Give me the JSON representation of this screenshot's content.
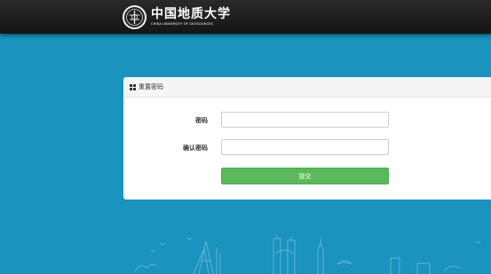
{
  "header": {
    "logo_cn": "中国地质大学",
    "logo_en": "CHINA UNIVERSITY OF GEOSCIENCES",
    "emblem_icon": "university-emblem-icon"
  },
  "panel": {
    "title": "重置密码",
    "title_icon": "grid-icon"
  },
  "form": {
    "password_label": "密码",
    "password_value": "",
    "confirm_label": "确认密码",
    "confirm_value": "",
    "submit_label": "提交"
  },
  "colors": {
    "background": "#1a93be",
    "topbar": "#1c1c1c",
    "submit": "#5cb85c"
  }
}
